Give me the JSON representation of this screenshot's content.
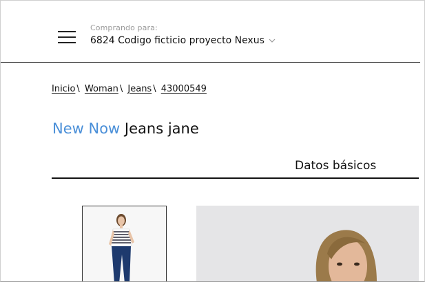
{
  "header": {
    "buying_for_label": "Comprando para:",
    "customer_name": "6824 Codigo ficticio proyecto Nexus"
  },
  "breadcrumb": {
    "items": [
      "Inicio",
      "Woman",
      "Jeans",
      "43000549"
    ]
  },
  "product": {
    "collection": "New Now",
    "name": "Jeans jane"
  },
  "tabs": {
    "basic_data": "Datos básicos"
  },
  "colors": {
    "accent": "#4a8fd8",
    "text": "#111111",
    "muted": "#9a9a9a"
  }
}
